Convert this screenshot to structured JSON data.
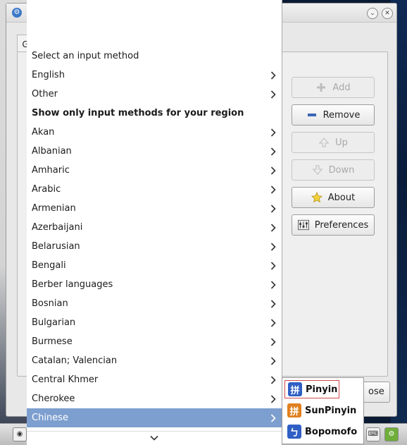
{
  "window": {
    "tab_stub": "G",
    "buttons": {
      "add": "Add",
      "remove": "Remove",
      "up": "Up",
      "down": "Down",
      "about": "About",
      "preferences": "Preferences",
      "close_partial": "ose"
    }
  },
  "menu": {
    "items": [
      {
        "label": "Select an input method",
        "arrow": false,
        "heading": false
      },
      {
        "label": "English",
        "arrow": true,
        "heading": false
      },
      {
        "label": "Other",
        "arrow": true,
        "heading": false
      },
      {
        "label": "Show only input methods for your region",
        "arrow": false,
        "heading": true
      },
      {
        "label": "Akan",
        "arrow": true,
        "heading": false
      },
      {
        "label": "Albanian",
        "arrow": true,
        "heading": false
      },
      {
        "label": "Amharic",
        "arrow": true,
        "heading": false
      },
      {
        "label": "Arabic",
        "arrow": true,
        "heading": false
      },
      {
        "label": "Armenian",
        "arrow": true,
        "heading": false
      },
      {
        "label": "Azerbaijani",
        "arrow": true,
        "heading": false
      },
      {
        "label": "Belarusian",
        "arrow": true,
        "heading": false
      },
      {
        "label": "Bengali",
        "arrow": true,
        "heading": false
      },
      {
        "label": "Berber languages",
        "arrow": true,
        "heading": false
      },
      {
        "label": "Bosnian",
        "arrow": true,
        "heading": false
      },
      {
        "label": "Bulgarian",
        "arrow": true,
        "heading": false
      },
      {
        "label": "Burmese",
        "arrow": true,
        "heading": false
      },
      {
        "label": "Catalan; Valencian",
        "arrow": true,
        "heading": false
      },
      {
        "label": "Central Khmer",
        "arrow": true,
        "heading": false
      },
      {
        "label": "Cherokee",
        "arrow": true,
        "heading": false
      },
      {
        "label": "Chinese",
        "arrow": true,
        "heading": false,
        "highlighted": true
      }
    ]
  },
  "submenu": {
    "items": [
      {
        "label": "Pinyin",
        "icon": "pinyin-icon",
        "glyph": "拼",
        "color": "#2f5fc4"
      },
      {
        "label": "SunPinyin",
        "icon": "sunpinyin-icon",
        "glyph": "拼",
        "color": "#e0801f"
      },
      {
        "label": "Bopomofo",
        "icon": "bopomofo-icon",
        "glyph": "ㄅ",
        "color": "#2f5fc4"
      }
    ]
  },
  "colors": {
    "highlight": "#7d9fcf",
    "desktop": "#0b1a33"
  }
}
